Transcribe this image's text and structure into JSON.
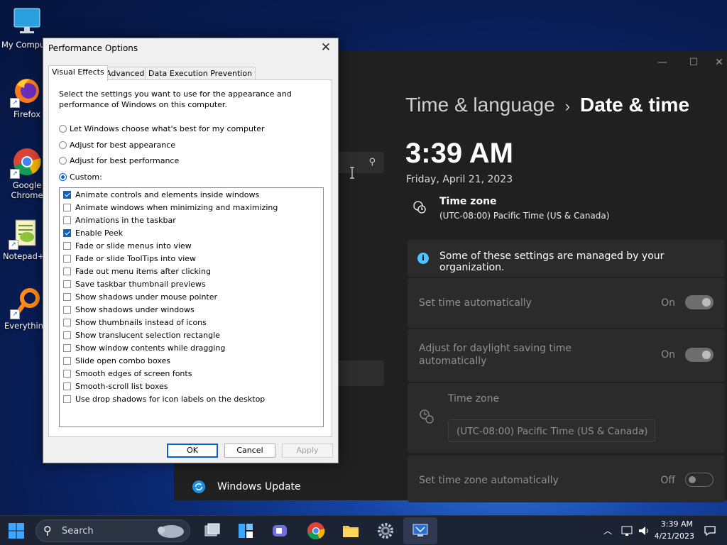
{
  "desktop": {
    "icons": [
      {
        "label": "My Compu",
        "icon": "computer-icon"
      },
      {
        "label": "Firefox",
        "icon": "firefox-icon"
      },
      {
        "label": "Google Chrome",
        "icon": "chrome-icon"
      },
      {
        "label": "Notepad+",
        "icon": "notepadpp-icon"
      },
      {
        "label": "Everythin",
        "icon": "everything-icon"
      }
    ]
  },
  "settings": {
    "breadcrumb_parent": "Time & language",
    "breadcrumb_sep": "›",
    "breadcrumb_current": "Date & time",
    "time": "3:39 AM",
    "date": "Friday, April 21, 2023",
    "timezone_title": "Time zone",
    "timezone_value": "(UTC-08:00) Pacific Time (US & Canada)",
    "info_text": "Some of these settings are managed by your organization.",
    "set_time_auto": {
      "label": "Set time automatically",
      "state": "On"
    },
    "dst": {
      "label_line1": "Adjust for daylight saving time",
      "label_line2": "automatically",
      "state": "On"
    },
    "tz_card": {
      "label": "Time zone",
      "value": "(UTC-08:00) Pacific Time (US & Canada)"
    },
    "tz_auto": {
      "label": "Set time zone automatically",
      "state": "Off"
    },
    "nav_windows_update": "Windows Update"
  },
  "dialog": {
    "title": "Performance Options",
    "tabs": [
      "Visual Effects",
      "Advanced",
      "Data Execution Prevention"
    ],
    "description": "Select the settings you want to use for the appearance and performance of Windows on this computer.",
    "radios": [
      {
        "label": "Let Windows choose what's best for my computer",
        "selected": false
      },
      {
        "label": "Adjust for best appearance",
        "selected": false
      },
      {
        "label": "Adjust for best performance",
        "selected": false
      },
      {
        "label": "Custom:",
        "selected": true
      }
    ],
    "options": [
      {
        "label": "Animate controls and elements inside windows",
        "checked": true
      },
      {
        "label": "Animate windows when minimizing and maximizing",
        "checked": false
      },
      {
        "label": "Animations in the taskbar",
        "checked": false
      },
      {
        "label": "Enable Peek",
        "checked": true
      },
      {
        "label": "Fade or slide menus into view",
        "checked": false
      },
      {
        "label": "Fade or slide ToolTips into view",
        "checked": false
      },
      {
        "label": "Fade out menu items after clicking",
        "checked": false
      },
      {
        "label": "Save taskbar thumbnail previews",
        "checked": false
      },
      {
        "label": "Show shadows under mouse pointer",
        "checked": false
      },
      {
        "label": "Show shadows under windows",
        "checked": false
      },
      {
        "label": "Show thumbnails instead of icons",
        "checked": false
      },
      {
        "label": "Show translucent selection rectangle",
        "checked": false
      },
      {
        "label": "Show window contents while dragging",
        "checked": false
      },
      {
        "label": "Slide open combo boxes",
        "checked": false
      },
      {
        "label": "Smooth edges of screen fonts",
        "checked": false
      },
      {
        "label": "Smooth-scroll list boxes",
        "checked": false
      },
      {
        "label": "Use drop shadows for icon labels on the desktop",
        "checked": false
      }
    ],
    "ok": "OK",
    "cancel": "Cancel",
    "apply": "Apply"
  },
  "taskbar": {
    "search_label": "Search",
    "clock_time": "3:39 AM",
    "clock_date": "4/21/2023"
  },
  "colors": {
    "accent": "#0a64c8",
    "settings_bg": "#202020",
    "card_bg": "#2b2b2b",
    "info": "#4cc2ff"
  }
}
